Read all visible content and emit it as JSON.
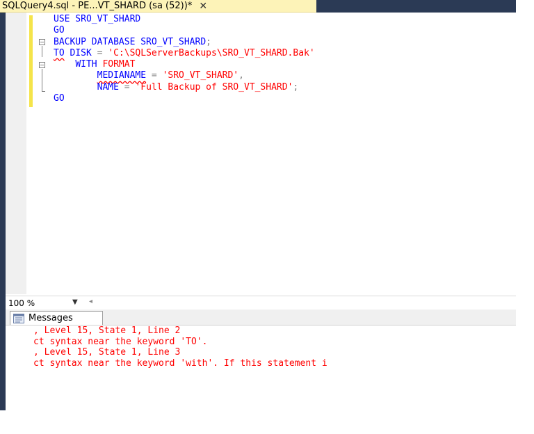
{
  "tab": {
    "title": "SQLQuery4.sql - PE...VT_SHARD (sa (52))*",
    "close_glyph": "✕"
  },
  "editor": {
    "lines": [
      {
        "indent": "",
        "tokens": [
          {
            "t": "USE",
            "c": "kw"
          },
          {
            "t": " SRO_VT_SHARD",
            "c": "kw"
          }
        ]
      },
      {
        "indent": "",
        "tokens": [
          {
            "t": "GO",
            "c": "kw"
          }
        ]
      },
      {
        "indent": "",
        "tokens": [
          {
            "t": "BACKUP DATABASE",
            "c": "kw"
          },
          {
            "t": " SRO_VT_SHARD",
            "c": "kw"
          },
          {
            "t": ";",
            "c": "gray"
          }
        ]
      },
      {
        "indent": "",
        "tokens": [
          {
            "t": "TO",
            "c": "kw squig"
          },
          {
            "t": " DISK",
            "c": "kw"
          },
          {
            "t": " = ",
            "c": "gray"
          },
          {
            "t": "'C:\\SQLServerBackups\\SRO_VT_SHARD.Bak'",
            "c": "str"
          }
        ]
      },
      {
        "indent": "    ",
        "tokens": [
          {
            "t": "WITH",
            "c": "kw"
          },
          {
            "t": " FORMAT",
            "c": "str"
          }
        ]
      },
      {
        "indent": "        ",
        "tokens": [
          {
            "t": "MEDIANAME",
            "c": "kw squig"
          },
          {
            "t": " = ",
            "c": "gray"
          },
          {
            "t": "'SRO_VT_SHARD'",
            "c": "str"
          },
          {
            "t": ",",
            "c": "gray"
          }
        ]
      },
      {
        "indent": "        ",
        "tokens": [
          {
            "t": "NAME",
            "c": "kw"
          },
          {
            "t": " = ",
            "c": "gray"
          },
          {
            "t": "'Full Backup of SRO_VT_SHARD'",
            "c": "str"
          },
          {
            "t": ";",
            "c": "gray"
          }
        ]
      },
      {
        "indent": "",
        "tokens": [
          {
            "t": "GO",
            "c": "kw"
          }
        ]
      }
    ]
  },
  "zoom": {
    "value": "100 %"
  },
  "results": {
    "tab_label": "Messages",
    "messages": [
      ", Level 15, State 1, Line 2",
      "ct syntax near the keyword 'TO'.",
      ", Level 15, State 1, Line 3",
      "ct syntax near the keyword 'with'. If this statement i"
    ]
  },
  "colors": {
    "keyword": "#0000ff",
    "string": "#ff0000",
    "error": "#ff0000",
    "tab_bg": "#fdf3b8",
    "frame": "#2b3a55"
  }
}
